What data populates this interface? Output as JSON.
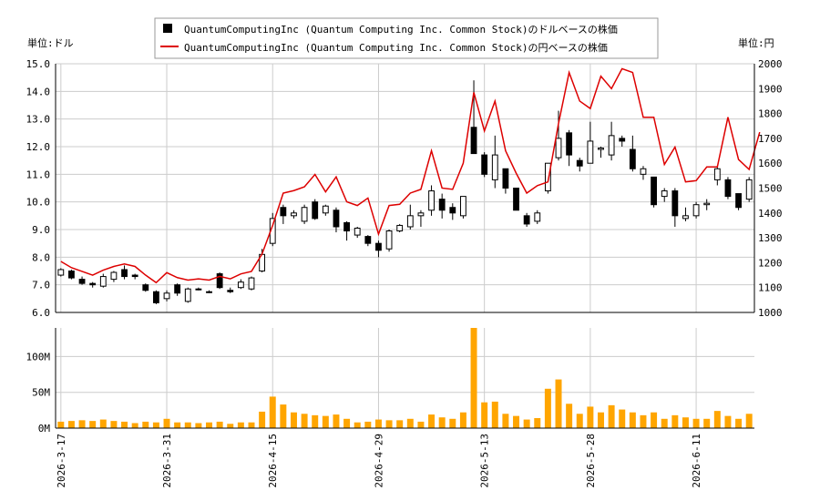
{
  "legend": {
    "candle_label": "QuantumComputingInc (Quantum Computing Inc. Common Stock)のドルベースの株価",
    "line_label": "QuantumComputingInc (Quantum Computing Inc. Common Stock)の円ベースの株価"
  },
  "left_unit": "単位:ドル",
  "right_unit": "単位:円",
  "colors": {
    "line": "#dd0000",
    "volume": "#ffa500",
    "up_body": "#ffffff",
    "down_body": "#000000",
    "grid": "#cccccc"
  },
  "chart_data": {
    "type": "candlestick+line+bar",
    "y_left_range": [
      6.0,
      15.0
    ],
    "y_left_ticks": [
      "6.0",
      "7.0",
      "8.0",
      "9.0",
      "10.0",
      "11.0",
      "12.0",
      "13.0",
      "14.0",
      "15.0"
    ],
    "y_right_range": [
      1000,
      2000
    ],
    "y_right_ticks": [
      "1000",
      "1100",
      "1200",
      "1300",
      "1400",
      "1500",
      "1600",
      "1700",
      "1800",
      "1900",
      "2000"
    ],
    "volume_range": [
      0,
      140
    ],
    "volume_ticks": [
      "0M",
      "50M",
      "100M"
    ],
    "volume_tick_values": [
      0,
      50,
      100
    ],
    "x_tick_labels": [
      "2026-3-17",
      "2026-3-31",
      "2026-4-15",
      "2026-4-29",
      "2026-5-13",
      "2026-5-28",
      "2026-6-11"
    ],
    "x_tick_index": [
      0,
      10,
      20,
      30,
      40,
      50,
      60
    ],
    "ohlc": [
      [
        7.35,
        7.6,
        7.3,
        7.55
      ],
      [
        7.5,
        7.55,
        7.2,
        7.25
      ],
      [
        7.2,
        7.3,
        7.0,
        7.05
      ],
      [
        7.05,
        7.1,
        6.9,
        7.0
      ],
      [
        6.95,
        7.4,
        6.9,
        7.3
      ],
      [
        7.2,
        7.5,
        7.1,
        7.45
      ],
      [
        7.55,
        7.7,
        7.2,
        7.3
      ],
      [
        7.35,
        7.4,
        7.2,
        7.3
      ],
      [
        7.0,
        7.05,
        6.75,
        6.8
      ],
      [
        6.75,
        6.8,
        6.3,
        6.35
      ],
      [
        6.5,
        6.8,
        6.4,
        6.7
      ],
      [
        7.0,
        7.05,
        6.6,
        6.7
      ],
      [
        6.4,
        6.9,
        6.35,
        6.85
      ],
      [
        6.85,
        6.9,
        6.8,
        6.85
      ],
      [
        6.75,
        6.8,
        6.7,
        6.75
      ],
      [
        7.4,
        7.45,
        6.85,
        6.9
      ],
      [
        6.8,
        6.9,
        6.7,
        6.75
      ],
      [
        6.9,
        7.2,
        6.85,
        7.1
      ],
      [
        6.85,
        7.3,
        6.8,
        7.25
      ],
      [
        7.5,
        8.3,
        7.45,
        8.1
      ],
      [
        8.5,
        9.6,
        8.4,
        9.4
      ],
      [
        9.8,
        9.9,
        9.2,
        9.5
      ],
      [
        9.5,
        9.7,
        9.4,
        9.6
      ],
      [
        9.3,
        9.9,
        9.2,
        9.8
      ],
      [
        10.0,
        10.1,
        9.35,
        9.4
      ],
      [
        9.6,
        9.9,
        9.5,
        9.85
      ],
      [
        9.7,
        9.8,
        8.9,
        9.1
      ],
      [
        9.25,
        9.3,
        8.6,
        8.95
      ],
      [
        8.8,
        9.1,
        8.7,
        9.05
      ],
      [
        8.75,
        8.8,
        8.4,
        8.5
      ],
      [
        8.5,
        8.6,
        8.0,
        8.25
      ],
      [
        8.3,
        9.0,
        8.2,
        8.95
      ],
      [
        8.95,
        9.2,
        8.9,
        9.15
      ],
      [
        9.1,
        9.9,
        9.0,
        9.5
      ],
      [
        9.5,
        9.7,
        9.1,
        9.6
      ],
      [
        9.7,
        10.6,
        9.5,
        10.4
      ],
      [
        10.1,
        10.3,
        9.4,
        9.7
      ],
      [
        9.8,
        9.95,
        9.35,
        9.6
      ],
      [
        9.5,
        10.2,
        9.4,
        10.2
      ],
      [
        12.7,
        14.4,
        12.6,
        11.75
      ],
      [
        11.7,
        11.8,
        10.9,
        11.0
      ],
      [
        10.8,
        12.4,
        10.5,
        11.7
      ],
      [
        11.2,
        11.2,
        10.3,
        10.5
      ],
      [
        10.5,
        10.5,
        9.8,
        9.7
      ],
      [
        9.5,
        9.6,
        9.1,
        9.2
      ],
      [
        9.3,
        9.7,
        9.2,
        9.6
      ],
      [
        10.4,
        11.3,
        10.3,
        11.4
      ],
      [
        11.6,
        13.3,
        11.5,
        12.3
      ],
      [
        12.5,
        12.6,
        11.3,
        11.7
      ],
      [
        11.5,
        11.6,
        11.1,
        11.3
      ],
      [
        11.4,
        12.9,
        11.4,
        12.2
      ],
      [
        11.9,
        12.0,
        11.6,
        11.95
      ],
      [
        11.7,
        12.9,
        11.5,
        12.4
      ],
      [
        12.3,
        12.4,
        12.0,
        12.2
      ],
      [
        11.9,
        12.4,
        11.1,
        11.2
      ],
      [
        11.0,
        11.3,
        10.8,
        11.2
      ],
      [
        10.9,
        10.9,
        9.8,
        9.9
      ],
      [
        10.2,
        10.5,
        10.0,
        10.4
      ],
      [
        10.4,
        10.5,
        9.1,
        9.5
      ],
      [
        9.4,
        9.8,
        9.3,
        9.5
      ],
      [
        9.5,
        10.0,
        9.4,
        9.9
      ],
      [
        9.9,
        10.1,
        9.7,
        9.95
      ],
      [
        10.8,
        11.3,
        10.6,
        11.2
      ],
      [
        10.8,
        10.9,
        10.1,
        10.2
      ],
      [
        10.3,
        10.3,
        9.7,
        9.8
      ],
      [
        10.1,
        10.9,
        10.0,
        10.8
      ]
    ],
    "yen_line": [
      1205,
      1180,
      1165,
      1150,
      1170,
      1185,
      1195,
      1185,
      1150,
      1120,
      1160,
      1140,
      1130,
      1135,
      1130,
      1145,
      1135,
      1155,
      1165,
      1235,
      1350,
      1480,
      1490,
      1505,
      1555,
      1485,
      1545,
      1445,
      1430,
      1460,
      1315,
      1430,
      1435,
      1480,
      1495,
      1650,
      1500,
      1495,
      1600,
      1885,
      1730,
      1850,
      1650,
      1560,
      1480,
      1510,
      1525,
      1760,
      1965,
      1850,
      1820,
      1950,
      1900,
      1980,
      1965,
      1785,
      1785,
      1595,
      1665,
      1525,
      1530,
      1585,
      1585,
      1785,
      1615,
      1575,
      1725
    ],
    "volume": [
      9,
      10,
      11,
      10,
      12,
      10,
      9,
      7,
      9,
      8,
      13,
      8,
      8,
      7,
      8,
      9,
      6,
      8,
      8,
      23,
      44,
      33,
      22,
      20,
      18,
      17,
      19,
      13,
      8,
      9,
      12,
      11,
      11,
      13,
      9,
      19,
      15,
      13,
      22,
      140,
      36,
      37,
      20,
      17,
      12,
      14,
      55,
      68,
      34,
      20,
      30,
      22,
      32,
      26,
      22,
      18,
      22,
      13,
      18,
      15,
      13,
      13,
      24,
      17,
      13,
      20
    ]
  }
}
